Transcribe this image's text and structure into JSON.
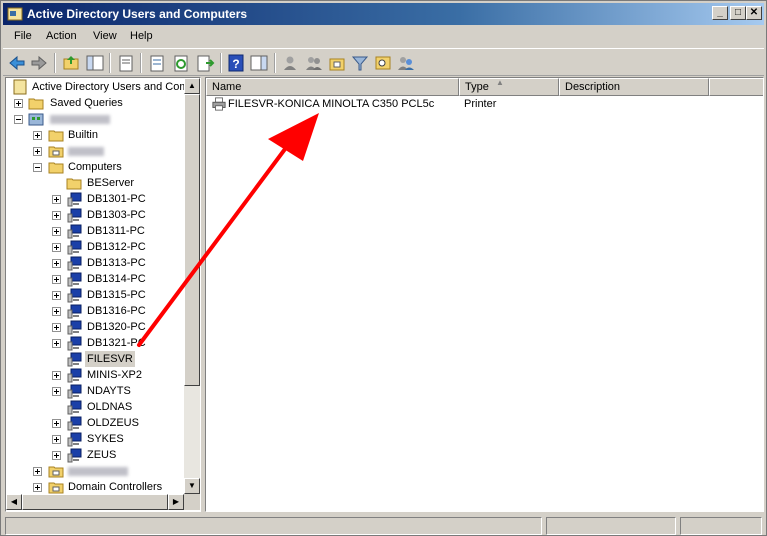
{
  "window": {
    "title": "Active Directory Users and Computers",
    "minimize_label": "_",
    "maximize_label": "□",
    "close_label": "✕"
  },
  "menu": {
    "file": "File",
    "action": "Action",
    "view": "View",
    "help": "Help"
  },
  "toolbar": {
    "icons": [
      "back-icon",
      "forward-icon",
      "up-folder-icon",
      "show-console-tree-icon",
      "properties-icon",
      "export-list-icon",
      "refresh-icon",
      "export-icon",
      "help-icon",
      "action-pane-icon",
      "new-user-icon",
      "new-group-icon",
      "new-ou-icon",
      "filter-icon",
      "find-icon",
      "add-to-group-icon"
    ]
  },
  "tree": {
    "root_label": "Active Directory Users and Com",
    "saved_queries": "Saved Queries",
    "builtin": "Builtin",
    "computers": "Computers",
    "items": [
      "BEServer",
      "DB1301-PC",
      "DB1303-PC",
      "DB1311-PC",
      "DB1312-PC",
      "DB1313-PC",
      "DB1314-PC",
      "DB1315-PC",
      "DB1316-PC",
      "DB1320-PC",
      "DB1321-PC",
      "FILESVR",
      "MINIS-XP2",
      "NDAYTS",
      "OLDNAS",
      "OLDZEUS",
      "SYKES",
      "ZEUS"
    ],
    "domain_controllers": "Domain Controllers"
  },
  "list": {
    "columns": {
      "name": "Name",
      "type": "Type",
      "description": "Description"
    },
    "rows": [
      {
        "name": "FILESVR-KONICA MINOLTA C350 PCL5c",
        "type": "Printer",
        "description": ""
      }
    ]
  },
  "annotation": {
    "arrow_color": "#ff0000"
  }
}
